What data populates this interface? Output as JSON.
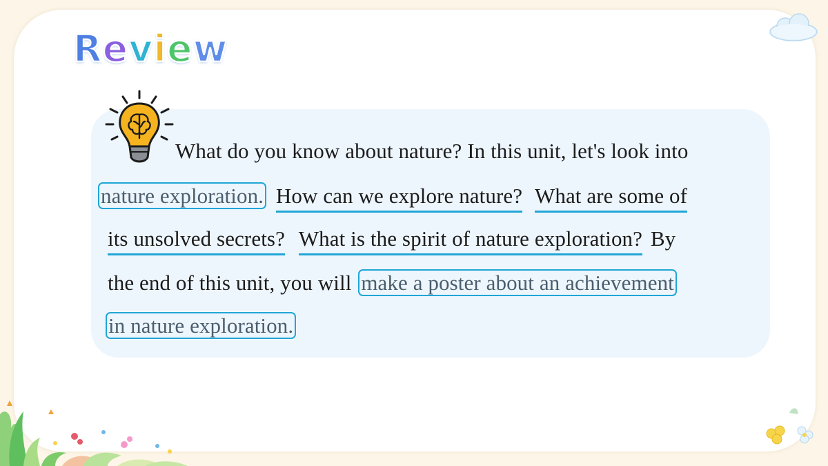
{
  "slide": {
    "title_letters": [
      {
        "ch": "R",
        "color": "#4f7fe3"
      },
      {
        "ch": "e",
        "color": "#8a5fe0"
      },
      {
        "ch": "v",
        "color": "#2fb3d3"
      },
      {
        "ch": "i",
        "color": "#f0b82a"
      },
      {
        "ch": "e",
        "color": "#4fc56b"
      },
      {
        "ch": "w",
        "color": "#5f8ee8"
      }
    ]
  },
  "paragraph": {
    "s1": "What do you know about nature? In this unit, let's look into",
    "box1": "nature exploration.",
    "q1": "How can we explore nature?",
    "q2a": "What are some of",
    "q2b": "its unsolved secrets?",
    "q3": "What is the spirit of nature exploration?",
    "s2": "By",
    "s3": "the end of this unit, you will",
    "box2a": "make a poster about an achievement",
    "box2b": "in nature exploration."
  },
  "colors": {
    "highlight": "#1fa6d6",
    "panel": "#eef6fd",
    "bulb": "#f5b41f"
  }
}
